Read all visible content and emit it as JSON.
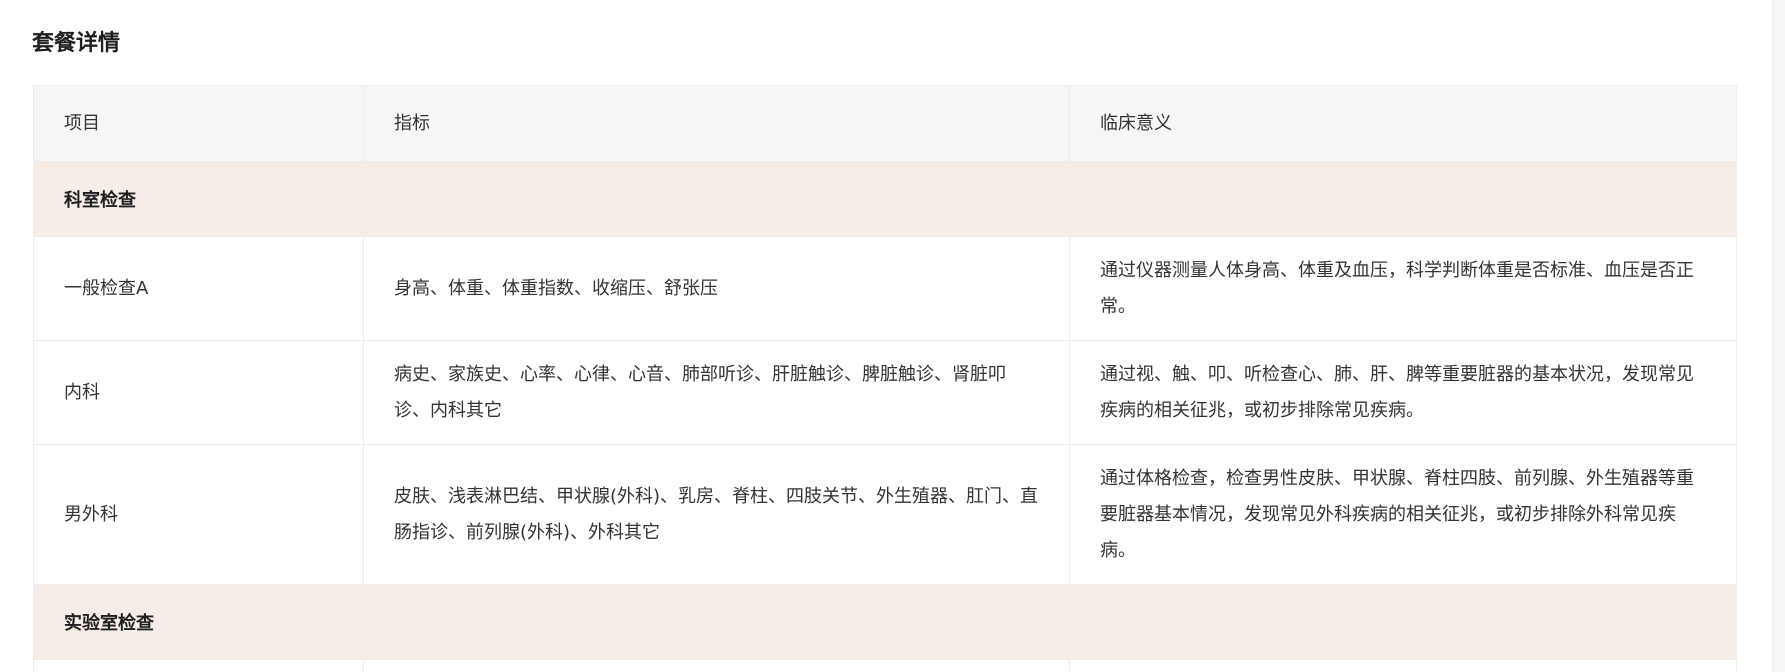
{
  "section": {
    "title": "套餐详情"
  },
  "table": {
    "headers": [
      "项目",
      "指标",
      "临床意义"
    ],
    "categories": {
      "dept": "科室检查",
      "lab": "实验室检查"
    },
    "rows": [
      {
        "item": "一般检查A",
        "indicator": "身高、体重、体重指数、收缩压、舒张压",
        "meaning": "通过仪器测量人体身高、体重及血压，科学判断体重是否标准、血压是否正常。"
      },
      {
        "item": "内科",
        "indicator": "病史、家族史、心率、心律、心音、肺部听诊、肝脏触诊、脾脏触诊、肾脏叩诊、内科其它",
        "meaning": "通过视、触、叩、听检查心、肺、肝、脾等重要脏器的基本状况，发现常见疾病的相关征兆，或初步排除常见疾病。"
      },
      {
        "item": "男外科",
        "indicator": "皮肤、浅表淋巴结、甲状腺(外科)、乳房、脊柱、四肢关节、外生殖器、肛门、直肠指诊、前列腺(外科)、外科其它",
        "meaning": "通过体格检查，检查男性皮肤、甲状腺、脊柱四肢、前列腺、外生殖器等重要脏器基本情况，发现常见外科疾病的相关征兆，或初步排除外科常见疾病。"
      }
    ]
  }
}
